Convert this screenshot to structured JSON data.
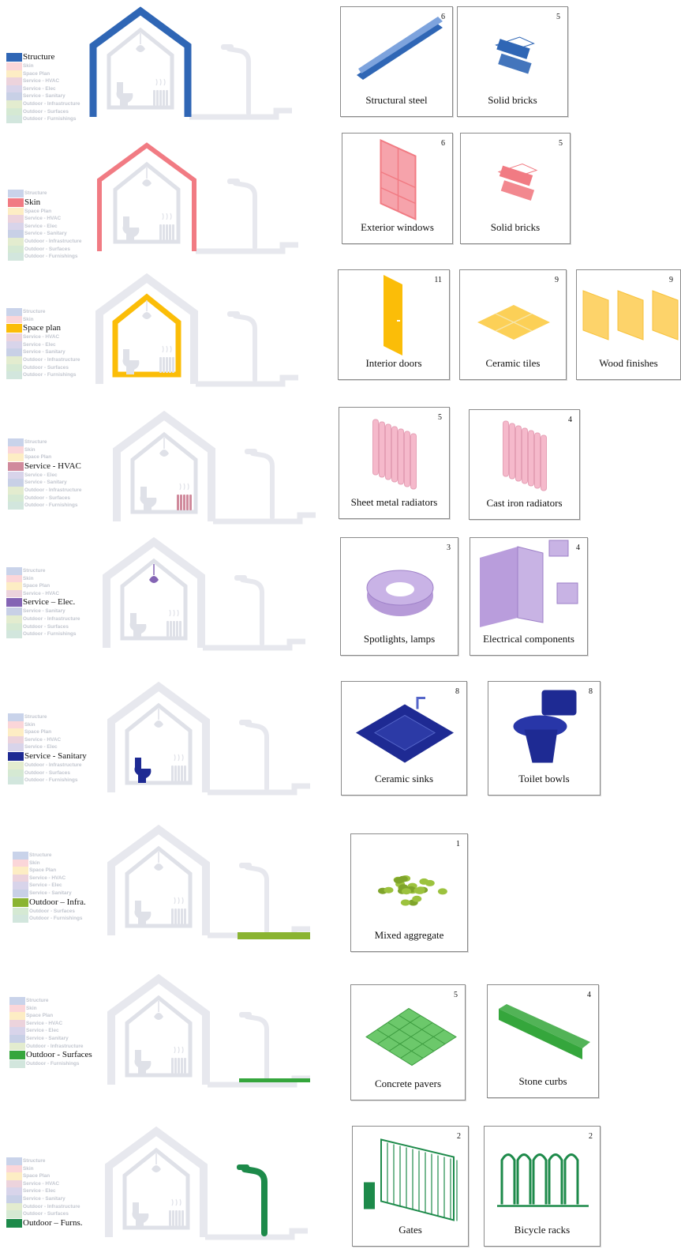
{
  "legend_categories": [
    "Structure",
    "Skin",
    "Space Plan",
    "Service - HVAC",
    "Service - Elec",
    "Service - Sanitary",
    "Outdoor - Infrastructure",
    "Outdoor - Surfaces",
    "Outdoor - Furnishings"
  ],
  "layer_colors": [
    "#c9d3ea",
    "#fbd6d9",
    "#fdedc4",
    "#ecd3dc",
    "#d8d4ea",
    "#c8d0e6",
    "#e3eccf",
    "#d5e9d3",
    "#d2e6dd"
  ],
  "rows": [
    {
      "active_label": "Structure",
      "color": "#2f66b5",
      "items": [
        {
          "label": "Structural steel",
          "count": "6"
        },
        {
          "label": "Solid bricks",
          "count": "5"
        }
      ]
    },
    {
      "active_label": "Skin",
      "color": "#f17b83",
      "items": [
        {
          "label": "Exterior windows",
          "count": "6"
        },
        {
          "label": "Solid bricks",
          "count": "5"
        }
      ]
    },
    {
      "active_label": "Space  plan",
      "color": "#fbbd08",
      "items": [
        {
          "label": "Interior doors",
          "count": "11"
        },
        {
          "label": "Ceramic tiles",
          "count": "9"
        },
        {
          "label": "Wood finishes",
          "count": "9"
        }
      ]
    },
    {
      "active_label": "Service - HVAC",
      "color": "#d08a9c",
      "items": [
        {
          "label": "Sheet metal radiators",
          "count": "5"
        },
        {
          "label": "Cast iron radiators",
          "count": "4"
        }
      ]
    },
    {
      "active_label": "Service – Elec.",
      "color": "#8464b4",
      "items": [
        {
          "label": "Spotlights, lamps",
          "count": "3"
        },
        {
          "label": "Electrical components",
          "count": "4"
        }
      ]
    },
    {
      "active_label": "Service - Sanitary",
      "color": "#1e2a93",
      "items": [
        {
          "label": "Ceramic sinks",
          "count": "8"
        },
        {
          "label": "Toilet bowls",
          "count": "8"
        }
      ]
    },
    {
      "active_label": "Outdoor – Infra.",
      "color": "#8ab431",
      "items": [
        {
          "label": "Mixed aggregate",
          "count": "1"
        }
      ]
    },
    {
      "active_label": "Outdoor - Surfaces",
      "color": "#35a63c",
      "items": [
        {
          "label": "Concrete pavers",
          "count": "5"
        },
        {
          "label": "Stone curbs",
          "count": "4"
        }
      ]
    },
    {
      "active_label": "Outdoor – Furns.",
      "color": "#1d8a4a",
      "items": [
        {
          "label": "Gates",
          "count": "2"
        },
        {
          "label": "Bicycle racks",
          "count": "2"
        }
      ]
    }
  ]
}
